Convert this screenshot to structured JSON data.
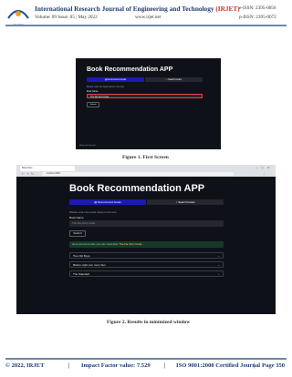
{
  "header": {
    "logo_text": "IRJET",
    "journal_title_main": "International Research Journal of Engineering and Technology",
    "journal_abbr": "(IRJET)",
    "e_issn": "e-ISSN: 2395-0056",
    "volume_issue": "Volume: 09 Issue: 05 | May 2022",
    "website": "www.irjet.net",
    "p_issn": "p-ISSN: 2395-0072"
  },
  "figure1": {
    "app_title": "Book Recommendation APP",
    "tabs": [
      "Recommend books",
      "Search books"
    ],
    "prompt": "Please enter the book name in the box",
    "field_label": "Book Name",
    "input_value": "The Da Vinci Code",
    "submit_label": "Submit",
    "footer_note": "Made with Streamlit",
    "caption": "Figure 1. First Screen"
  },
  "figure2": {
    "browser_tab": "Book Rec...",
    "address": "localhost:8501",
    "app_title": "Book Recommendation APP",
    "tabs": [
      "Recommend books",
      "Search books"
    ],
    "prompt": "Please enter the book name in the box",
    "field_label": "Book Name",
    "input_placeholder": "The Da Vinci Code",
    "submit_label": "Submit",
    "success_prefix": "Here are the books you can read after ",
    "success_book": "The Da Vinci Code",
    "results": [
      "Two Old Boys",
      "Before night one more Sun",
      "The Standard"
    ],
    "caption": "Figure 2. Results in minimized window"
  },
  "footer": {
    "copyright": "© 2022, IRJET",
    "impact": "Impact Factor value: 7.529",
    "iso": "ISO 9001:2008 Certified Journal",
    "page": "Page 350"
  },
  "colors": {
    "app_bg": "#0e1117",
    "accent_tab": "#1d1ab3",
    "input_bg": "#262730",
    "highlight_border": "#e0484d",
    "success_bg": "#173928",
    "journal_blue": "#1f3b73"
  }
}
